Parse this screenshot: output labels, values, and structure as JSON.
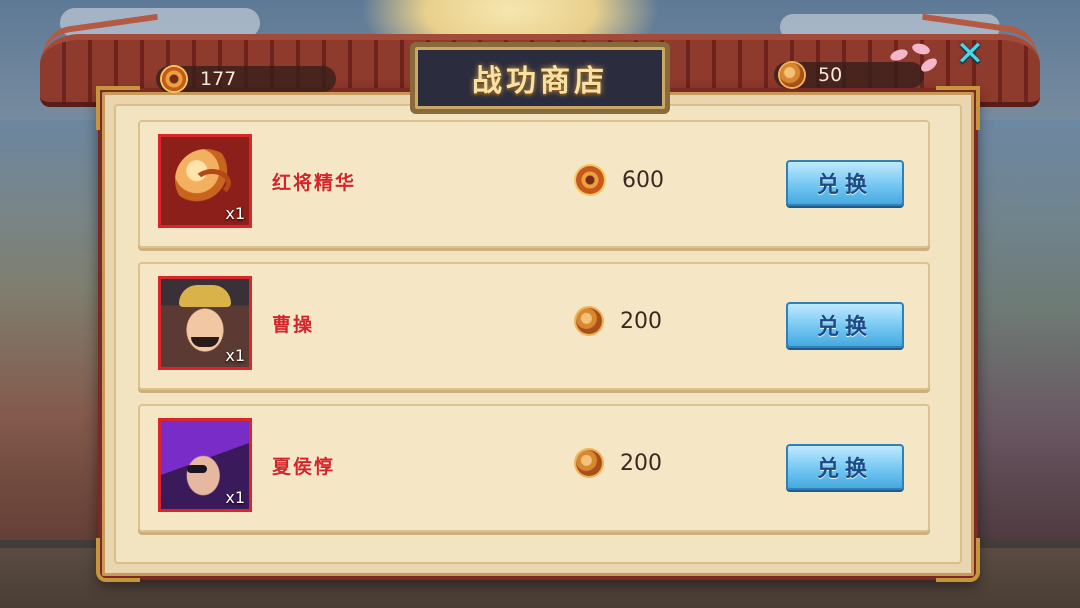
{
  "shop": {
    "title": "战功商店"
  },
  "currencies": {
    "merit": {
      "icon": "merit-medal-icon",
      "amount": "177"
    },
    "coin": {
      "icon": "bronze-coin-icon",
      "amount": "50"
    }
  },
  "items": [
    {
      "name": "红将精华",
      "quantity": "x1",
      "art": "red-general-essence",
      "price_icon": "merit-medal-icon",
      "price": "600",
      "button_label": "兑换"
    },
    {
      "name": "曹操",
      "quantity": "x1",
      "art": "cao-cao-portrait",
      "price_icon": "bronze-coin-icon",
      "price": "200",
      "button_label": "兑换"
    },
    {
      "name": "夏侯惇",
      "quantity": "x1",
      "art": "xiahou-dun-portrait",
      "price_icon": "bronze-coin-icon",
      "price": "200",
      "button_label": "兑换"
    }
  ],
  "close": {
    "icon": "close-x-icon",
    "label": "✕"
  },
  "colors": {
    "frame": "#7a2a22",
    "panel": "#f2e3c1",
    "item_name": "#d2262a",
    "button": "#74c7f2",
    "close": "#49d6e8"
  }
}
